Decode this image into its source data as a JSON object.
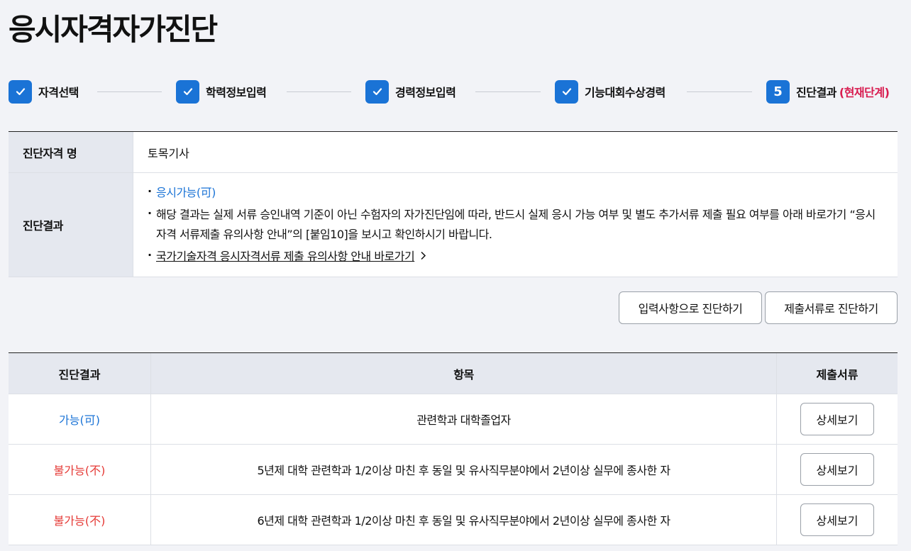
{
  "page_title": "응시자격자가진단",
  "steps": [
    {
      "label": "자격선택",
      "status": "done"
    },
    {
      "label": "학력정보입력",
      "status": "done"
    },
    {
      "label": "경력정보입력",
      "status": "done"
    },
    {
      "label": "기능대회수상경력",
      "status": "done"
    },
    {
      "label": "진단결과",
      "number": "5",
      "current_label": "(현재단계)",
      "status": "current"
    }
  ],
  "info": {
    "qual_name_label": "진단자격 명",
    "qual_name_value": "토목기사",
    "result_label": "진단결과",
    "result_status": "응시가능(可)",
    "result_notice": "해당 결과는 실제 서류 승인내역 기준이 아닌 수험자의 자가진단임에 따라, 반드시 실제 응시 가능 여부 및 별도 추가서류 제출 필요 여부를 아래 바로가기 “응시자격 서류제출 유의사항 안내”의 [붙임10]을 보시고 확인하시기 바랍니다.",
    "guide_link": "국가기술자격 응시자격서류 제출 유의사항 안내 바로가기"
  },
  "buttons": {
    "by_input": "입력사항으로 진단하기",
    "by_docs": "제출서류로 진단하기"
  },
  "result_table": {
    "headers": [
      "진단결과",
      "항목",
      "제출서류"
    ],
    "rows": [
      {
        "result": "가능(可)",
        "item": "관련학과 대학졸업자",
        "action": "상세보기"
      },
      {
        "result": "불가능(不)",
        "item": "5년제 대학 관련학과 1/2이상 마친 후 동일 및 유사직무분야에서 2년이상 실무에 종사한 자",
        "action": "상세보기"
      },
      {
        "result": "불가능(不)",
        "item": "6년제 대학 관련학과 1/2이상 마친 후 동일 및 유사직무분야에서 2년이상 실무에 종사한 자",
        "action": "상세보기"
      }
    ]
  },
  "colors": {
    "accent": "#1a73d6",
    "current_step": "#d81b4f",
    "negative": "#e53935",
    "header_bg": "#e5e8ef"
  },
  "icons": {
    "step_done": "check-icon",
    "link": "chevron-right-icon"
  }
}
